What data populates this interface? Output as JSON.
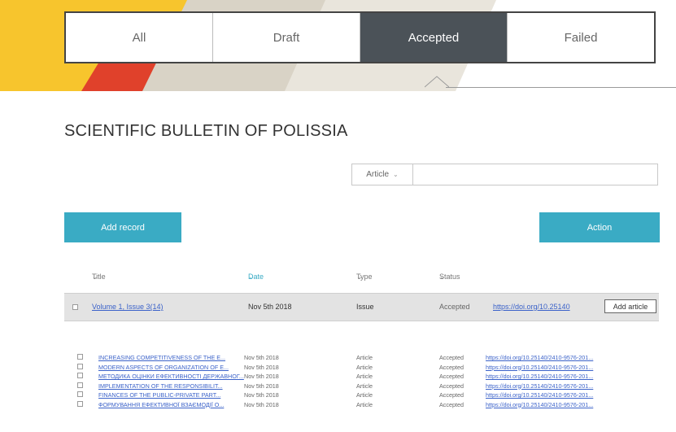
{
  "tabs": [
    {
      "label": "All",
      "active": false
    },
    {
      "label": "Draft",
      "active": false
    },
    {
      "label": "Accepted",
      "active": true
    },
    {
      "label": "Failed",
      "active": false
    }
  ],
  "colors": {
    "accent": "#3aabc4",
    "active_tab": "#4b5258",
    "banner_yellow": "#f7c52d",
    "banner_red": "#e0412b",
    "link": "#3b62c9"
  },
  "journal_title": "SCIENTIFIC BULLETIN OF POLISSIA",
  "search": {
    "type_selected": "Article",
    "query": ""
  },
  "buttons": {
    "add_record": "Add record",
    "action": "Action"
  },
  "columns": {
    "title": "Title",
    "date": "Date",
    "type": "Type",
    "status": "Status"
  },
  "issue_row": {
    "title": "Volume 1, Issue 3(14)",
    "date": "Nov 5th 2018",
    "type": "Issue",
    "status": "Accepted",
    "doi": "https://doi.org/10.25140",
    "add_article": "Add article"
  },
  "articles": [
    {
      "title": "INCREASING COMPETITIVENESS OF THE E...",
      "date": "Nov 5th 2018",
      "type": "Article",
      "status": "Accepted",
      "doi": "https://doi.org/10.25140/2410-9576-201..."
    },
    {
      "title": "MODERN ASPECTS OF ORGANIZATION OF E...",
      "date": "Nov 5th 2018",
      "type": "Article",
      "status": "Accepted",
      "doi": "https://doi.org/10.25140/2410-9576-201..."
    },
    {
      "title": "МЕТОДИКА ОЦІНКИ ЕФЕКТИВНОСТІ ДЕРЖАВНОГ...",
      "date": "Nov 5th 2018",
      "type": "Article",
      "status": "Accepted",
      "doi": "https://doi.org/10.25140/2410-9576-201..."
    },
    {
      "title": "IMPLEMENTATION OF THE RESPONSIBILIT...",
      "date": "Nov 5th 2018",
      "type": "Article",
      "status": "Accepted",
      "doi": "https://doi.org/10.25140/2410-9576-201..."
    },
    {
      "title": "FINANCES OF THE PUBLIC-PRIVATE PART...",
      "date": "Nov 5th 2018",
      "type": "Article",
      "status": "Accepted",
      "doi": "https://doi.org/10.25140/2410-9576-201..."
    },
    {
      "title": "ФОРМУВАННЯ ЕФЕКТИВНОЇ ВЗАЄМОДІЇ О...",
      "date": "Nov 5th 2018",
      "type": "Article",
      "status": "Accepted",
      "doi": "https://doi.org/10.25140/2410-9576-201..."
    }
  ]
}
